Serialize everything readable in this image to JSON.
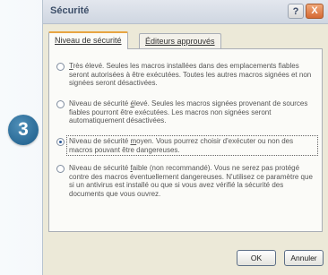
{
  "step_number": "3",
  "dialog": {
    "title": "Sécurité",
    "help_label": "?",
    "close_label": "X"
  },
  "tabs": [
    {
      "label": "Niveau de sécurité"
    },
    {
      "label": "Éditeurs approuvés"
    }
  ],
  "options": [
    {
      "underline_char": "T",
      "rest_text": "rès élevé. Seules les macros installées dans des emplacements fiables seront autorisées à être exécutées. Toutes les autres macros signées et non signées seront désactivées.",
      "checked": false
    },
    {
      "prefix": "Niveau de sécurité ",
      "underline_char": "é",
      "rest_text": "levé. Seules les macros signées provenant de sources fiables pourront être exécutées. Les macros non signées seront automatiquement désactivées.",
      "checked": false
    },
    {
      "prefix": "Niveau de sécurité ",
      "underline_char": "m",
      "rest_text": "oyen. Vous pourrez choisir d'exécuter ou non des macros pouvant être dangereuses.",
      "checked": true
    },
    {
      "prefix": "Niveau de sécurité ",
      "underline_char": "f",
      "rest_text": "aible (non recommandé). Vous ne serez pas protégé contre des macros éventuellement dangereuses. N'utilisez ce paramètre que si un antivirus est installé ou que si vous avez vérifié la sécurité des documents que vous ouvrez.",
      "checked": false
    }
  ],
  "buttons": {
    "ok": "OK",
    "cancel": "Annuler"
  }
}
